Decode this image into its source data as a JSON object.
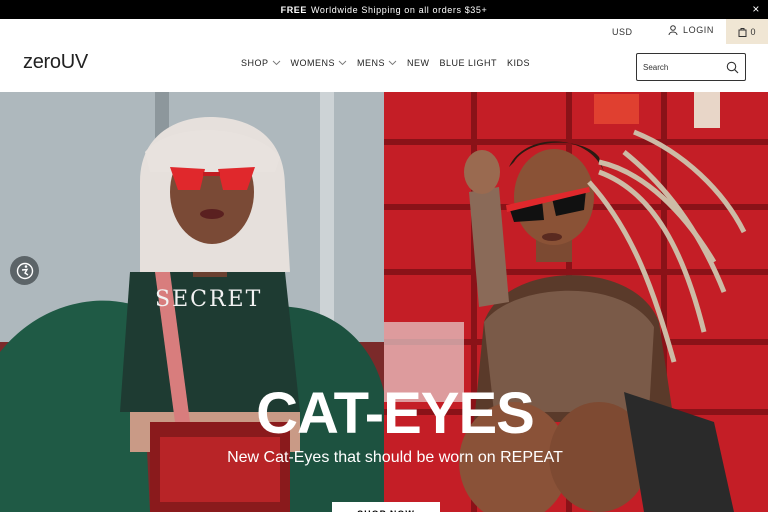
{
  "announcement": {
    "bold": "FREE",
    "text": "Worldwide Shipping on all orders $35+",
    "close": "×"
  },
  "header": {
    "currency": "USD",
    "login": "LOGIN",
    "cart_count": "0",
    "logo": "zeroUV",
    "search_placeholder": "Search"
  },
  "nav": {
    "items": [
      {
        "label": "SHOP",
        "dropdown": true
      },
      {
        "label": "WOMENS",
        "dropdown": true
      },
      {
        "label": "MENS",
        "dropdown": true
      },
      {
        "label": "NEW",
        "dropdown": false
      },
      {
        "label": "BLUE LIGHT",
        "dropdown": false
      },
      {
        "label": "KIDS",
        "dropdown": false
      }
    ]
  },
  "hero": {
    "title": "CAT-EYES",
    "subtitle": "New Cat-Eyes that should be worn on REPEAT",
    "button": "SHOP NOW",
    "shirt_text": "SECRET"
  },
  "colors": {
    "accent": "#f0e6d4",
    "hero_red": "#c8222a",
    "jacket_green": "#1f5a45"
  },
  "icons": {
    "login": "user-icon",
    "cart": "bag-icon",
    "search": "search-icon",
    "accessibility": "accessibility-icon"
  }
}
